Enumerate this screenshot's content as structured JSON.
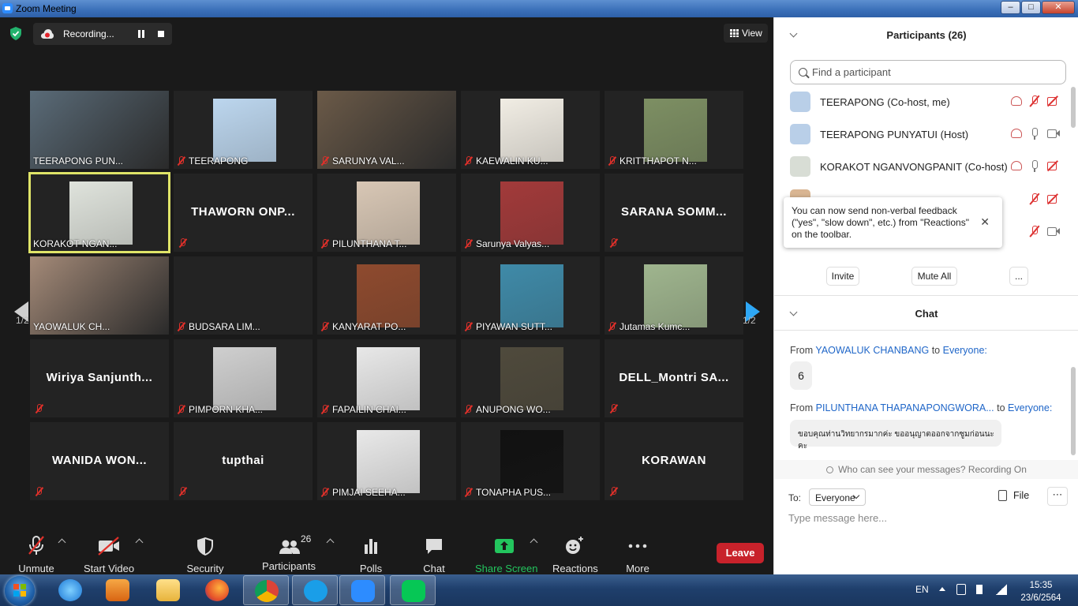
{
  "window": {
    "title": "Zoom Meeting",
    "min": "–",
    "max": "□",
    "close": "✕"
  },
  "topbar": {
    "recording_label": "Recording...",
    "view_label": "View"
  },
  "pager": {
    "left": "1/2",
    "right": "1/2"
  },
  "tiles": [
    {
      "name": "TEERAPONG PUN...",
      "type": "video",
      "muted": false,
      "color": "#5a6b78"
    },
    {
      "name": "TEERAPONG",
      "type": "photo",
      "muted": true,
      "color": "#bcd6ee"
    },
    {
      "name": "SARUNYA VAL...",
      "type": "video",
      "muted": true,
      "color": "#6b5a48"
    },
    {
      "name": "KAEWALIN KU...",
      "type": "photo",
      "muted": true,
      "color": "#f1ede4"
    },
    {
      "name": "KRITTHAPOT N...",
      "type": "photo",
      "muted": true,
      "color": "#7d8f63"
    },
    {
      "name": "KORAKOT NGAN...",
      "type": "photo",
      "muted": false,
      "active": true,
      "color": "#dfe3dc"
    },
    {
      "name": "",
      "bigname": "THAWORN  ONP...",
      "type": "name",
      "muted": true
    },
    {
      "name": "PILUNTHANA T...",
      "type": "photo",
      "muted": true,
      "color": "#d8c7b5"
    },
    {
      "name": "Sarunya Valyas...",
      "type": "photo",
      "muted": true,
      "color": "#a23a3a"
    },
    {
      "name": "",
      "bigname": "SARANA  SOMM...",
      "type": "name",
      "muted": true
    },
    {
      "name": "YAOWALUK CH...",
      "type": "video",
      "muted": false,
      "color": "#a48a78"
    },
    {
      "name": "BUDSARA LIM...",
      "type": "blank",
      "muted": true
    },
    {
      "name": "KANYARAT PO...",
      "type": "photo",
      "muted": true,
      "color": "#8e4a2e"
    },
    {
      "name": "PIYAWAN SUTT...",
      "type": "photo",
      "muted": true,
      "color": "#3f8aa8"
    },
    {
      "name": "Jutamas Kumc...",
      "type": "photo",
      "muted": true,
      "color": "#9fb58e"
    },
    {
      "name": "",
      "bigname": "Wiriya  Sanjunth...",
      "type": "name",
      "muted": true
    },
    {
      "name": "PIMPORN KHA...",
      "type": "photo",
      "muted": true,
      "color": "#cfcfcf"
    },
    {
      "name": "FAPAILIN CHAI...",
      "type": "photo",
      "muted": true,
      "color": "#e8e8e8"
    },
    {
      "name": "ANUPONG WO...",
      "type": "photo",
      "muted": true,
      "color": "#4f4a3c"
    },
    {
      "name": "",
      "bigname": "DELL_Montri  SA...",
      "type": "name",
      "muted": true
    },
    {
      "name": "",
      "bigname": "WANIDA  WON...",
      "type": "name",
      "muted": true
    },
    {
      "name": "",
      "bigname": "tupthai",
      "type": "name",
      "muted": true
    },
    {
      "name": "PIMJAI SEEHA...",
      "type": "photo",
      "muted": true,
      "color": "#e9e9e9"
    },
    {
      "name": "TONAPHA PUS...",
      "type": "photo",
      "muted": true,
      "color": "#111111"
    },
    {
      "name": "",
      "bigname": "KORAWAN",
      "type": "name",
      "muted": true
    }
  ],
  "toolbar": {
    "unmute": "Unmute",
    "start_video": "Start Video",
    "security": "Security",
    "participants": "Participants",
    "participants_count": "26",
    "polls": "Polls",
    "chat": "Chat",
    "share_screen": "Share Screen",
    "reactions": "Reactions",
    "more": "More",
    "leave": "Leave"
  },
  "participants": {
    "header": "Participants (26)",
    "search_placeholder": "Find a participant",
    "rows": [
      {
        "name": "TEERAPONG (Co-host, me)",
        "mic": "off",
        "cam": "off"
      },
      {
        "name": "TEERAPONG PUNYATUI (Host)",
        "mic": "on",
        "cam": "on"
      },
      {
        "name": "KORAKOT NGANVONGPANIT (Co-host)",
        "mic": "on",
        "cam": "off"
      }
    ],
    "tooltip": "You can now send non-verbal feedback (\"yes\", \"slow down\", etc.) from \"Reactions\" on the toolbar.",
    "tooltip_close": "✕",
    "invite": "Invite",
    "mute_all": "Mute All",
    "more": "..."
  },
  "chat": {
    "header": "Chat",
    "messages": [
      {
        "from_prefix": "From",
        "sender": "YAOWALUK CHANBANG",
        "to_prefix": "to",
        "to": "Everyone:",
        "text": "6"
      },
      {
        "from_prefix": "From",
        "sender": "PILUNTHANA THAPANAPONGWORA...",
        "to_prefix": "to",
        "to": "Everyone:",
        "text": "ขอบคุณท่านวิทยากรมากค่ะ ขออนุญาตออกจากซูมก่อนนะคะ"
      }
    ],
    "who_can_see": "Who can see your messages? Recording On",
    "to_label": "To:",
    "to_value": "Everyone",
    "file_label": "File",
    "more": "⋯",
    "input_placeholder": "Type message here..."
  },
  "taskbar": {
    "lang": "EN",
    "time": "15:35",
    "date": "23/6/2564"
  }
}
